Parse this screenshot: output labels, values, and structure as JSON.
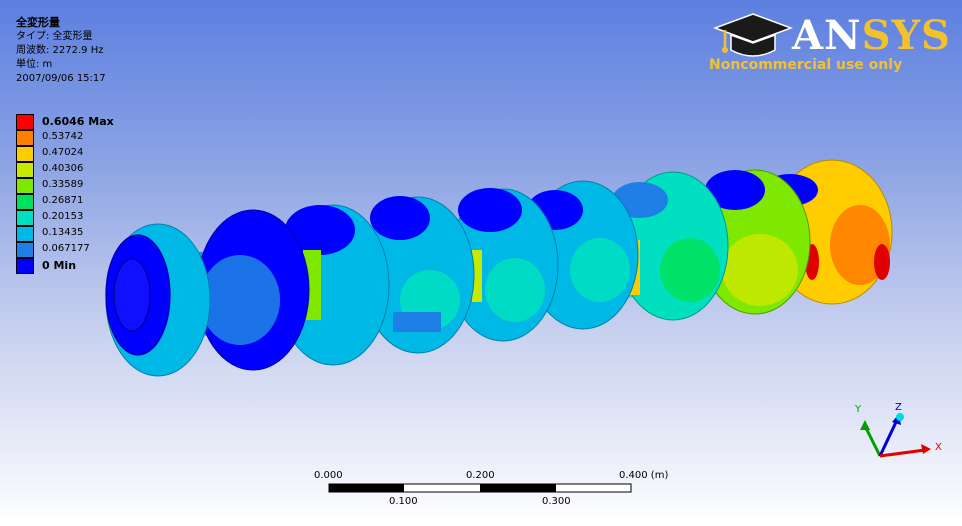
{
  "result": {
    "title": "全変形量",
    "type_line": "タイプ: 全変形量",
    "frequency_line": "周波数: 2272.9 Hz",
    "unit_line": "単位: m",
    "timestamp": "2007/09/06 15:17"
  },
  "legend": {
    "entries": [
      {
        "label": "0.6046 Max",
        "color": "#ff0000",
        "strong": true
      },
      {
        "label": "0.53742",
        "color": "#ff7f00"
      },
      {
        "label": "0.47024",
        "color": "#ffcc00"
      },
      {
        "label": "0.40306",
        "color": "#c7e800"
      },
      {
        "label": "0.33589",
        "color": "#7fe800"
      },
      {
        "label": "0.26871",
        "color": "#00e05a"
      },
      {
        "label": "0.20153",
        "color": "#00e0c0"
      },
      {
        "label": "0.13435",
        "color": "#00b8e6"
      },
      {
        "label": "0.067177",
        "color": "#1f7fe6"
      },
      {
        "label": "0 Min",
        "color": "#0000ff",
        "strong": true
      }
    ]
  },
  "logo": {
    "name_part1": "AN",
    "name_part2": "SYS",
    "tagline": "Noncommercial use only",
    "icon": "mortarboard-icon"
  },
  "triad": {
    "x": "X",
    "y": "Y",
    "z": "Z"
  },
  "scale_bar": {
    "top_labels": [
      "0.000",
      "0.200",
      "0.400 (m)"
    ],
    "bottom_labels": [
      "0.100",
      "0.300"
    ]
  }
}
